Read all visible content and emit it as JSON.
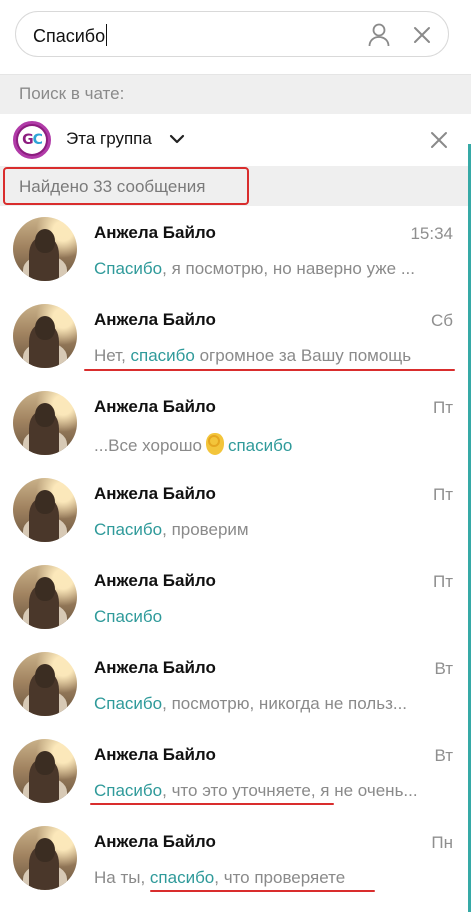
{
  "search": {
    "value": "Спасибо"
  },
  "search_in_chat_label": "Поиск в чате:",
  "group": {
    "name": "Эта группа",
    "avatar_text_g": "G",
    "avatar_text_c": "C"
  },
  "results": {
    "count_text": "Найдено 33 сообщения"
  },
  "messages": [
    {
      "name": "Анжела Байло",
      "time": "15:34",
      "highlight": "Спасибо",
      "before": "",
      "after": ", я посмотрю, но наверно уже ..."
    },
    {
      "name": "Анжела Байло",
      "time": "Сб",
      "before": "Нет, ",
      "highlight": "спасибо",
      "after": " огромное за Вашу помощь"
    },
    {
      "name": "Анжела Байло",
      "time": "Пт",
      "before": "...Все хорошо",
      "highlight": "спасибо",
      "after": ""
    },
    {
      "name": "Анжела Байло",
      "time": "Пт",
      "before": "",
      "highlight": "Спасибо",
      "after": ", проверим"
    },
    {
      "name": "Анжела Байло",
      "time": "Пт",
      "before": "",
      "highlight": "Спасибо",
      "after": ""
    },
    {
      "name": "Анжела Байло",
      "time": "Вт",
      "before": "",
      "highlight": "Спасибо",
      "after": ", посмотрю, никогда не польз..."
    },
    {
      "name": "Анжела Байло",
      "time": "Вт",
      "before": "",
      "highlight": "Спасибо",
      "after": ", что это уточняете, я не очень..."
    },
    {
      "name": "Анжела Байло",
      "time": "Пн",
      "before": "На ты, ",
      "highlight": "спасибо",
      "after": ", что проверяете"
    }
  ],
  "colors": {
    "accent": "#2f9a9a",
    "annotation": "#d92d2d",
    "group_avatar": "#8d1d80"
  },
  "icons": [
    "user-icon",
    "clear-icon",
    "chevron-down-icon",
    "close-icon",
    "ok-hand-emoji-icon"
  ]
}
